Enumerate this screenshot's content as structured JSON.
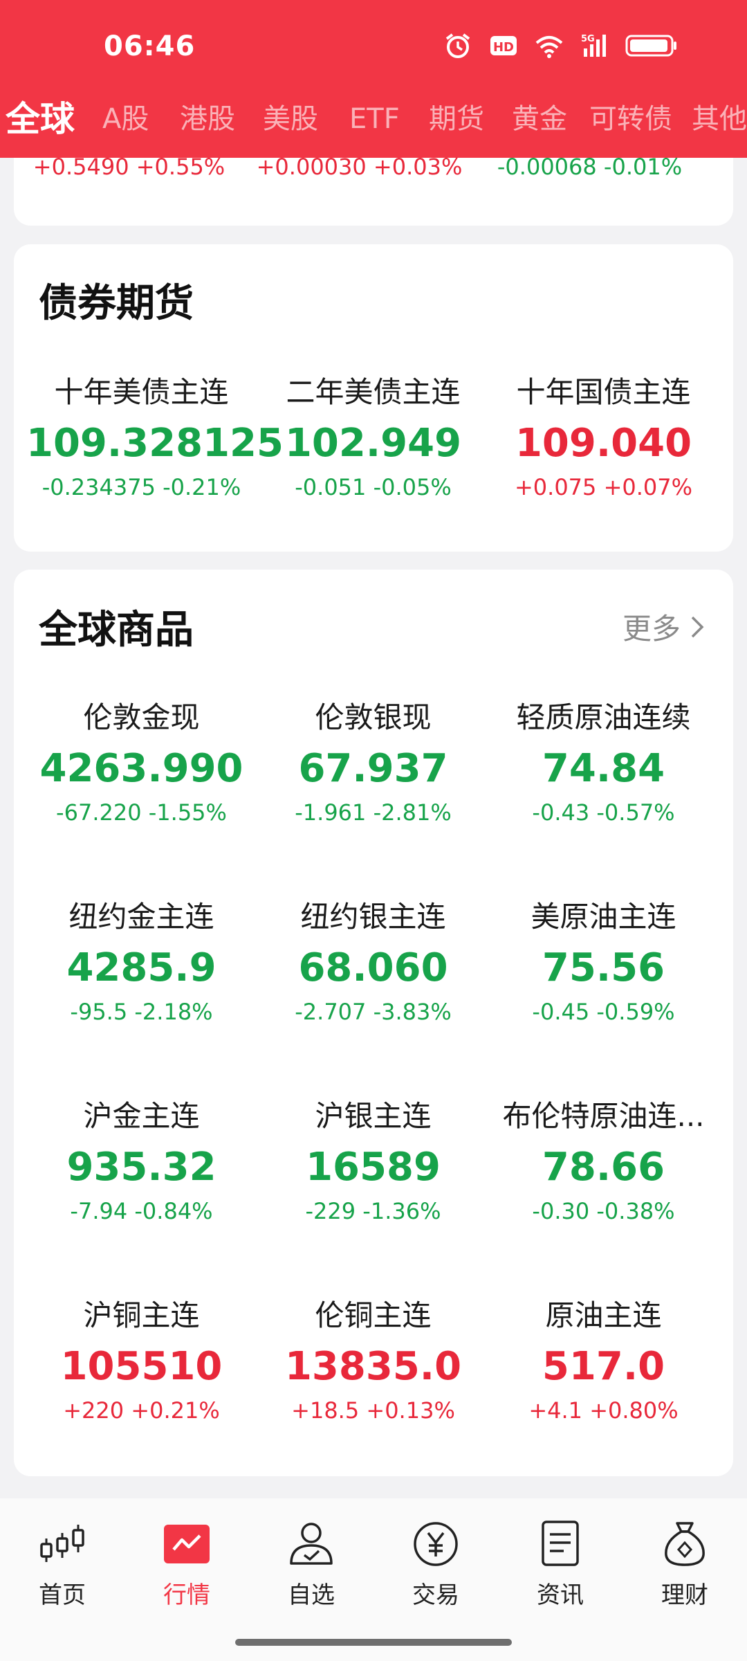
{
  "status": {
    "time": "06:46"
  },
  "tabs": [
    {
      "label": "全球",
      "active": true
    },
    {
      "label": "A股"
    },
    {
      "label": "港股"
    },
    {
      "label": "美股"
    },
    {
      "label": "ETF"
    },
    {
      "label": "期货"
    },
    {
      "label": "黄金"
    },
    {
      "label": "可转债"
    },
    {
      "label": "其他"
    }
  ],
  "top_partial": [
    {
      "change": "+0.5490 +0.55%",
      "direction": "up"
    },
    {
      "change": "+0.00030 +0.03%",
      "direction": "up"
    },
    {
      "change": "-0.00068 -0.01%",
      "direction": "down"
    }
  ],
  "bond_futures": {
    "title": "债券期货",
    "items": [
      {
        "name": "十年美债主连",
        "price": "109.328125",
        "change": "-0.234375 -0.21%",
        "direction": "down"
      },
      {
        "name": "二年美债主连",
        "price": "102.949",
        "change": "-0.051 -0.05%",
        "direction": "down"
      },
      {
        "name": "十年国债主连",
        "price": "109.040",
        "change": "+0.075 +0.07%",
        "direction": "up"
      }
    ]
  },
  "commodities": {
    "title": "全球商品",
    "more_label": "更多",
    "items": [
      {
        "name": "伦敦金现",
        "price": "4263.990",
        "change": "-67.220 -1.55%",
        "direction": "down"
      },
      {
        "name": "伦敦银现",
        "price": "67.937",
        "change": "-1.961 -2.81%",
        "direction": "down"
      },
      {
        "name": "轻质原油连续",
        "price": "74.84",
        "change": "-0.43 -0.57%",
        "direction": "down"
      },
      {
        "name": "纽约金主连",
        "price": "4285.9",
        "change": "-95.5 -2.18%",
        "direction": "down"
      },
      {
        "name": "纽约银主连",
        "price": "68.060",
        "change": "-2.707 -3.83%",
        "direction": "down"
      },
      {
        "name": "美原油主连",
        "price": "75.56",
        "change": "-0.45 -0.59%",
        "direction": "down"
      },
      {
        "name": "沪金主连",
        "price": "935.32",
        "change": "-7.94 -0.84%",
        "direction": "down"
      },
      {
        "name": "沪银主连",
        "price": "16589",
        "change": "-229 -1.36%",
        "direction": "down"
      },
      {
        "name": "布伦特原油连...",
        "price": "78.66",
        "change": "-0.30 -0.38%",
        "direction": "down"
      },
      {
        "name": "沪铜主连",
        "price": "105510",
        "change": "+220 +0.21%",
        "direction": "up"
      },
      {
        "name": "伦铜主连",
        "price": "13835.0",
        "change": "+18.5 +0.13%",
        "direction": "up"
      },
      {
        "name": "原油主连",
        "price": "517.0",
        "change": "+4.1 +0.80%",
        "direction": "up"
      }
    ]
  },
  "nav": [
    {
      "label": "首页",
      "icon": "candlestick-icon"
    },
    {
      "label": "行情",
      "icon": "market-chart-icon",
      "active": true
    },
    {
      "label": "自选",
      "icon": "user-check-icon"
    },
    {
      "label": "交易",
      "icon": "yen-coin-icon"
    },
    {
      "label": "资讯",
      "icon": "document-icon"
    },
    {
      "label": "理财",
      "icon": "money-bag-icon"
    }
  ],
  "colors": {
    "brand_red": "#f23645",
    "up": "#e8283a",
    "down": "#17a34a"
  }
}
